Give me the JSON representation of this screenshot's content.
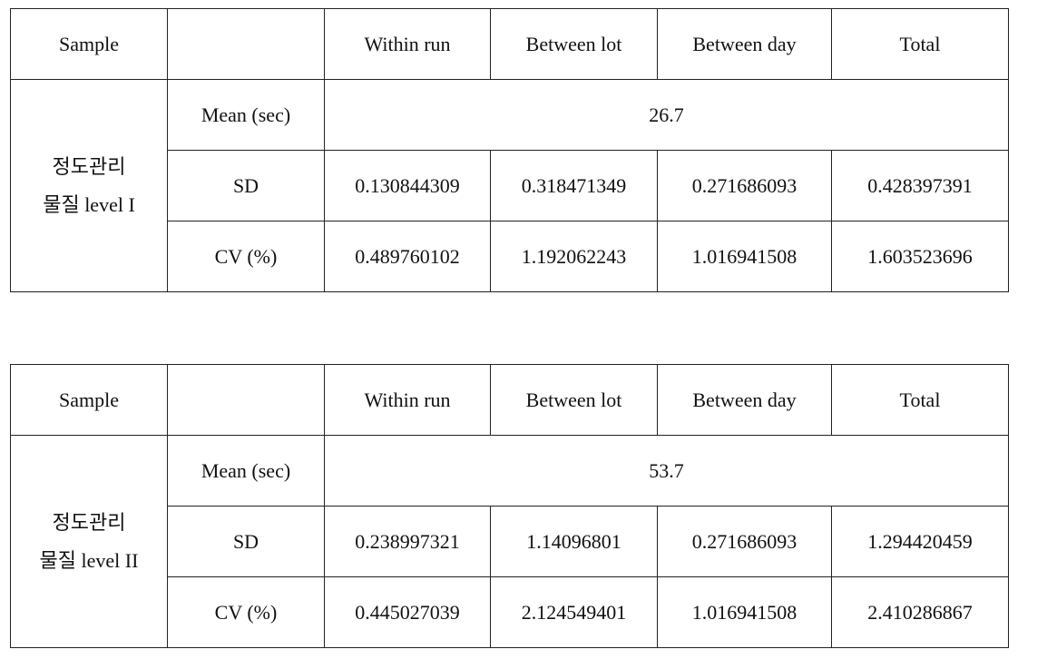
{
  "tables": [
    {
      "header": [
        "Sample",
        "",
        "Within run",
        "Between lot",
        "Between day",
        "Total"
      ],
      "sample_line1": "정도관리",
      "sample_line2": "물질 level I",
      "mean_label": "Mean  (sec)",
      "mean_value": "26.7",
      "rows": [
        {
          "label": "SD",
          "values": [
            "0.130844309",
            "0.318471349",
            "0.271686093",
            "0.428397391"
          ]
        },
        {
          "label": "CV (%)",
          "values": [
            "0.489760102",
            "1.192062243",
            "1.016941508",
            "1.603523696"
          ]
        }
      ]
    },
    {
      "header": [
        "Sample",
        "",
        "Within run",
        "Between lot",
        "Between day",
        "Total"
      ],
      "sample_line1": "정도관리",
      "sample_line2": "물질 level II",
      "mean_label": "Mean  (sec)",
      "mean_value": "53.7",
      "rows": [
        {
          "label": "SD",
          "values": [
            "0.238997321",
            "1.14096801",
            "0.271686093",
            "1.294420459"
          ]
        },
        {
          "label": "CV (%)",
          "values": [
            "0.445027039",
            "2.124549401",
            "1.016941508",
            "2.410286867"
          ]
        }
      ]
    }
  ]
}
